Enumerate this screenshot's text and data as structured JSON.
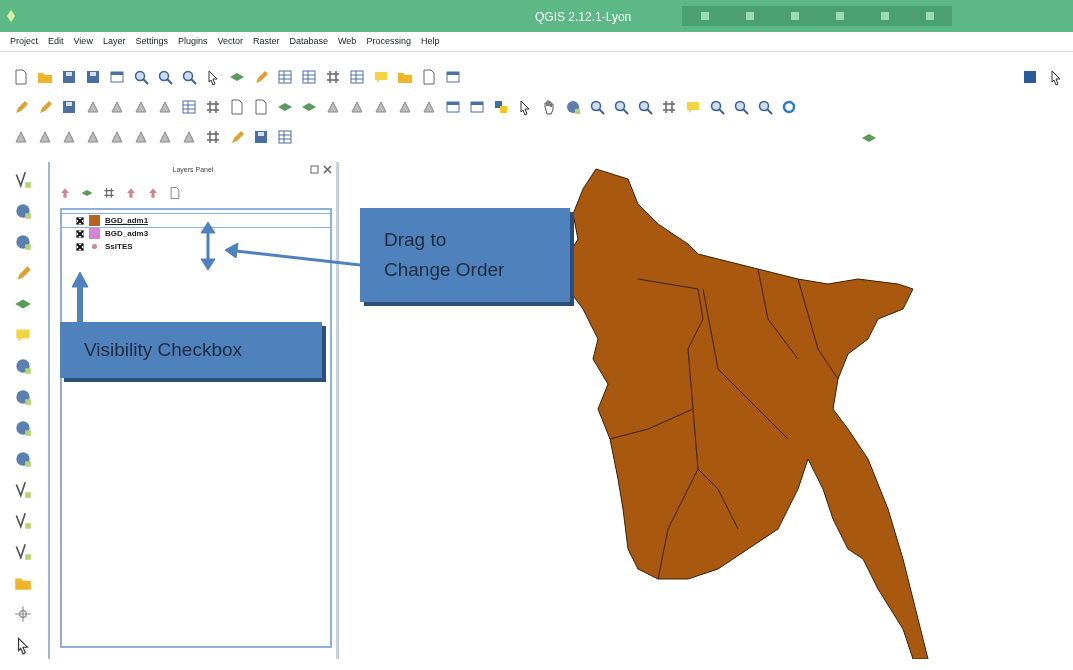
{
  "window": {
    "title": "QGIS 2.12.1-Lyon"
  },
  "menu": [
    "Project",
    "Edit",
    "View",
    "Layer",
    "Settings",
    "Plugins",
    "Vector",
    "Raster",
    "Database",
    "Web",
    "Processing",
    "Help"
  ],
  "layers_panel": {
    "title": "Layers Panel",
    "layers": [
      {
        "name": "BGD_adm1",
        "kind": "polygon",
        "color": "#b5651d",
        "checked": true,
        "selected": true
      },
      {
        "name": "BGD_adm3",
        "kind": "polygon",
        "color": "#d783d6",
        "checked": true,
        "selected": false
      },
      {
        "name": "SsITES",
        "kind": "point",
        "color": "#c98b8b",
        "checked": true,
        "selected": false
      }
    ]
  },
  "callouts": [
    {
      "text": "Drag to\nChange Order"
    },
    {
      "text": "Visibility Checkbox"
    }
  ]
}
